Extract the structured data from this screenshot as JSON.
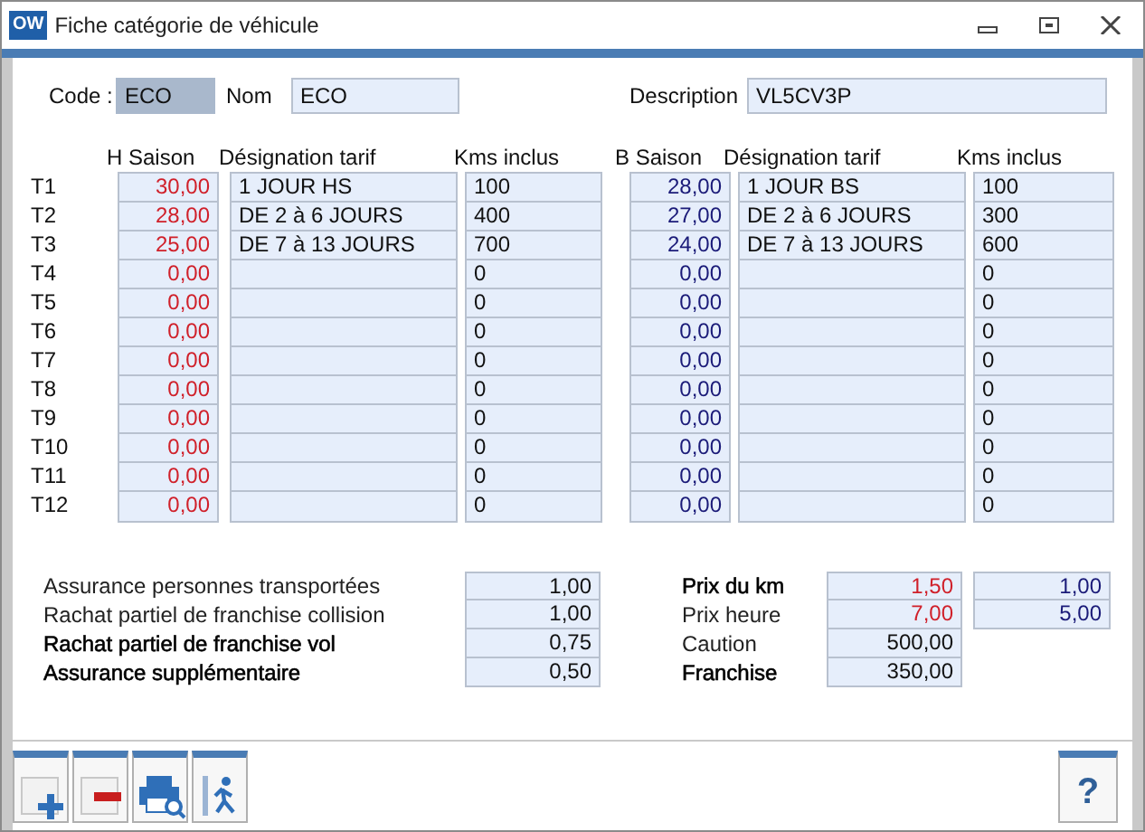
{
  "window": {
    "app_icon": "OW",
    "title": "Fiche catégorie de véhicule"
  },
  "header": {
    "code_label": "Code :",
    "code": "ECO",
    "nom_label": "Nom",
    "nom": "ECO",
    "description_label": "Description",
    "description": "VL5CV3P"
  },
  "columns": [
    "H Saison",
    "Désignation tarif",
    "Kms inclus",
    "B Saison",
    "Désignation tarif",
    "Kms inclus"
  ],
  "tariffs": [
    {
      "label": "T1",
      "h_price": "30,00",
      "h_designation": "1 JOUR HS",
      "h_kms": "100",
      "b_price": "28,00",
      "b_designation": "1 JOUR BS",
      "b_kms": "100"
    },
    {
      "label": "T2",
      "h_price": "28,00",
      "h_designation": "DE 2 à 6 JOURS",
      "h_kms": "400",
      "b_price": "27,00",
      "b_designation": "DE 2 à 6 JOURS",
      "b_kms": "300"
    },
    {
      "label": "T3",
      "h_price": "25,00",
      "h_designation": "DE 7 à 13 JOURS",
      "h_kms": "700",
      "b_price": "24,00",
      "b_designation": "DE 7 à 13 JOURS",
      "b_kms": "600"
    },
    {
      "label": "T4",
      "h_price": "0,00",
      "h_kms": "0",
      "b_price": "0,00",
      "b_kms": "0"
    },
    {
      "label": "T5",
      "h_price": "0,00",
      "h_kms": "0",
      "b_price": "0,00",
      "b_kms": "0"
    },
    {
      "label": "T6",
      "h_price": "0,00",
      "h_kms": "0",
      "b_price": "0,00",
      "b_kms": "0"
    },
    {
      "label": "T7",
      "h_price": "0,00",
      "h_kms": "0",
      "b_price": "0,00",
      "b_kms": "0"
    },
    {
      "label": "T8",
      "h_price": "0,00",
      "h_kms": "0",
      "b_price": "0,00",
      "b_kms": "0"
    },
    {
      "label": "T9",
      "h_price": "0,00",
      "h_kms": "0",
      "b_price": "0,00",
      "b_kms": "0"
    },
    {
      "label": "T10",
      "h_price": "0,00",
      "h_kms": "0",
      "b_price": "0,00",
      "b_kms": "0"
    },
    {
      "label": "T11",
      "h_price": "0,00",
      "h_kms": "0",
      "b_price": "0,00",
      "b_kms": "0"
    },
    {
      "label": "T12",
      "h_price": "0,00",
      "h_kms": "0",
      "b_price": "0,00",
      "b_kms": "0"
    }
  ],
  "insurance": [
    {
      "label": "Assurance personnes transportées",
      "bold": false,
      "value": "1,00"
    },
    {
      "label": "Rachat partiel de franchise collision",
      "bold": false,
      "value": "1,00"
    },
    {
      "label": "Rachat partiel de franchise vol",
      "bold": true,
      "value": "0,75"
    },
    {
      "label": "Assurance supplémentaire",
      "bold": true,
      "value": "0,50"
    }
  ],
  "prices": [
    {
      "label": "Prix du km",
      "bold": true,
      "values": [
        {
          "text": "1,50",
          "color": "#d0202a"
        },
        {
          "text": "1,00",
          "color": "#1a1a78"
        }
      ]
    },
    {
      "label": "Prix heure",
      "bold": false,
      "values": [
        {
          "text": "7,00",
          "color": "#d0202a"
        },
        {
          "text": "5,00",
          "color": "#1a1a78"
        }
      ]
    },
    {
      "label": "Caution",
      "bold": false,
      "values": [
        {
          "text": "500,00",
          "color": "#111111"
        }
      ]
    },
    {
      "label": "Franchise",
      "bold": true,
      "values": [
        {
          "text": "350,00",
          "color": "#111111"
        }
      ]
    }
  ],
  "toolbar": [
    {
      "kind": "add"
    },
    {
      "kind": "delete"
    },
    {
      "kind": "print-preview"
    },
    {
      "kind": "exit"
    }
  ],
  "help": {
    "label": "?"
  }
}
